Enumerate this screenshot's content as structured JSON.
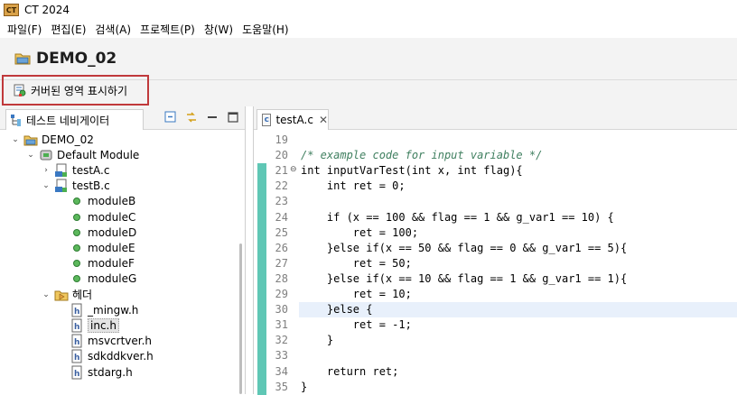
{
  "window": {
    "title": "CT 2024",
    "logo_text": "CT"
  },
  "menu": [
    "파일(F)",
    "편집(E)",
    "검색(A)",
    "프로젝트(P)",
    "창(W)",
    "도움말(H)"
  ],
  "project": {
    "name": "DEMO_02"
  },
  "toolbar": {
    "coverage_label": "커버된 영역 표시하기"
  },
  "navigator": {
    "tab_label": "테스트 네비게이터",
    "tree": [
      {
        "label": "DEMO_02",
        "twisty": "⌄",
        "icon": "project-icon",
        "indent": 0
      },
      {
        "label": "Default Module",
        "twisty": "⌄",
        "icon": "module-icon",
        "indent": 1
      },
      {
        "label": "testA.c",
        "twisty": "›",
        "icon": "c-file-icon",
        "indent": 2
      },
      {
        "label": "testB.c",
        "twisty": "⌄",
        "icon": "c-file-icon",
        "indent": 2
      },
      {
        "label": "moduleB",
        "twisty": "",
        "icon": "function-icon",
        "indent": 3
      },
      {
        "label": "moduleC",
        "twisty": "",
        "icon": "function-icon",
        "indent": 3
      },
      {
        "label": "moduleD",
        "twisty": "",
        "icon": "function-icon",
        "indent": 3
      },
      {
        "label": "moduleE",
        "twisty": "",
        "icon": "function-icon",
        "indent": 3
      },
      {
        "label": "moduleF",
        "twisty": "",
        "icon": "function-icon",
        "indent": 3
      },
      {
        "label": "moduleG",
        "twisty": "",
        "icon": "function-icon",
        "indent": 3
      },
      {
        "label": "헤더",
        "twisty": "⌄",
        "icon": "folder-icon",
        "indent": 2
      },
      {
        "label": "_mingw.h",
        "twisty": "",
        "icon": "h-file-icon",
        "indent": 3
      },
      {
        "label": "inc.h",
        "twisty": "",
        "icon": "h-file-icon",
        "indent": 3,
        "selected": true
      },
      {
        "label": "msvcrtver.h",
        "twisty": "",
        "icon": "h-file-icon",
        "indent": 3
      },
      {
        "label": "sdkddkver.h",
        "twisty": "",
        "icon": "h-file-icon",
        "indent": 3
      },
      {
        "label": "stdarg.h",
        "twisty": "",
        "icon": "h-file-icon",
        "indent": 3
      }
    ]
  },
  "editor": {
    "tab_label": "testA.c",
    "tab_icon_text": "c",
    "close_glyph": "✕",
    "highlight_line": 30,
    "fold_line": 21,
    "lines": [
      {
        "n": "19",
        "text": ""
      },
      {
        "n": "20",
        "text": "/* example code for input variable */",
        "comment": true
      },
      {
        "n": "21",
        "text": "int inputVarTest(int x, int flag){"
      },
      {
        "n": "22",
        "text": "    int ret = 0;"
      },
      {
        "n": "23",
        "text": ""
      },
      {
        "n": "24",
        "text": "    if (x == 100 && flag == 1 && g_var1 == 10) {"
      },
      {
        "n": "25",
        "text": "        ret = 100;"
      },
      {
        "n": "26",
        "text": "    }else if(x == 50 && flag == 0 && g_var1 == 5){"
      },
      {
        "n": "27",
        "text": "        ret = 50;"
      },
      {
        "n": "28",
        "text": "    }else if(x == 10 && flag == 1 && g_var1 == 1){"
      },
      {
        "n": "29",
        "text": "        ret = 10;"
      },
      {
        "n": "30",
        "text": "    }else {"
      },
      {
        "n": "31",
        "text": "        ret = -1;"
      },
      {
        "n": "32",
        "text": "    }"
      },
      {
        "n": "33",
        "text": ""
      },
      {
        "n": "34",
        "text": "    return ret;"
      },
      {
        "n": "35",
        "text": "}"
      }
    ]
  },
  "colors": {
    "coverage": "#5fc7b5",
    "highlight_box": "#c0393b",
    "comment": "#3f7f5f"
  }
}
